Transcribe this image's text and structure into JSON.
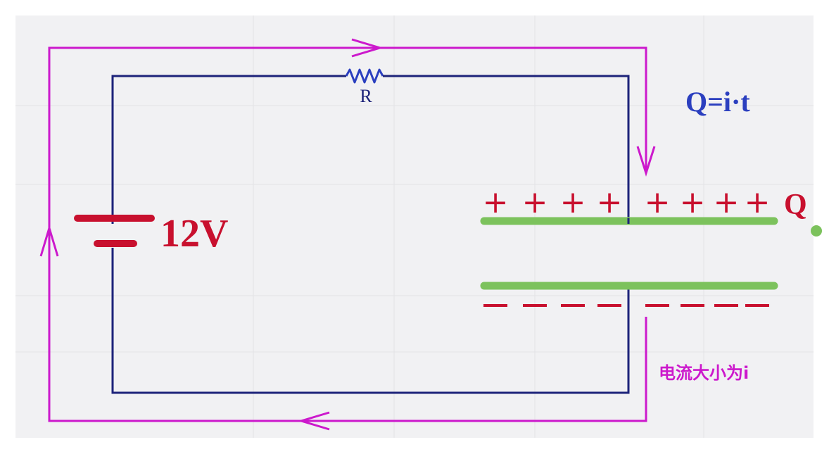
{
  "labels": {
    "resistor": "R",
    "voltage": "12V",
    "formula": "Q=i·t",
    "charge": "Q",
    "current_caption": "电流大小为i"
  },
  "plate_signs": {
    "positive": [
      "+",
      "+",
      "+",
      "+",
      "+",
      "+",
      "+",
      "+",
      "+",
      "+"
    ],
    "negative": [
      "−",
      "−",
      "−",
      "−",
      "−",
      "−",
      "−",
      "−",
      "−",
      "−"
    ]
  },
  "colors": {
    "wire": "#1d237a",
    "current": "#cc19cc",
    "battery": "#c8102e",
    "plate": "#7cc25c",
    "formula": "#2b3fbf",
    "background": "#f1f1f3"
  }
}
